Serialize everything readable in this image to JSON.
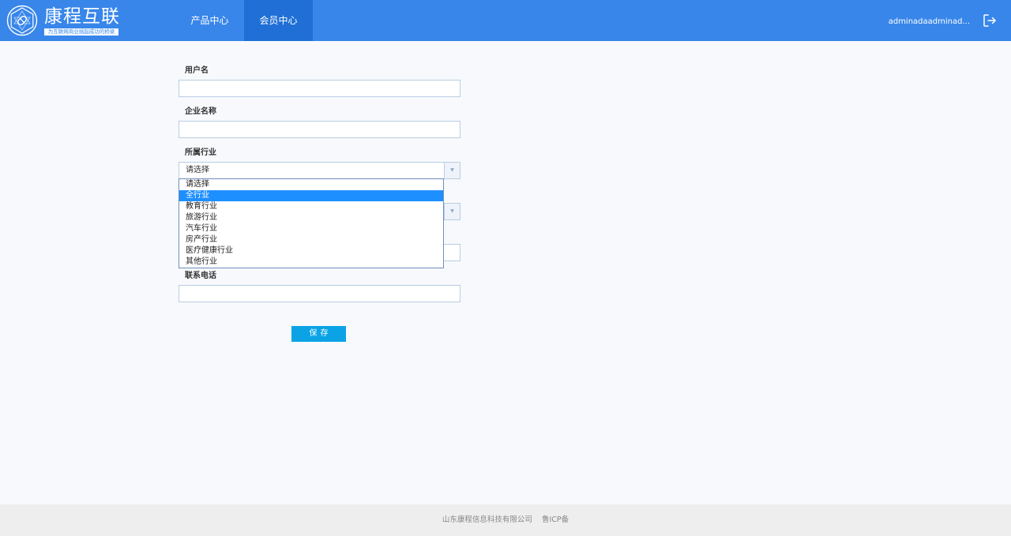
{
  "brand": {
    "title": "康程互联",
    "slogan": "为互联网商业插起成功的桥梁",
    "primary_color": "#3886ea"
  },
  "nav": {
    "items": [
      {
        "label": "产品中心",
        "active": false
      },
      {
        "label": "会员中心",
        "active": true
      }
    ]
  },
  "user": {
    "name": "adminadaadminad...",
    "logout_icon": "logout-icon"
  },
  "form": {
    "username": {
      "label": "用户名",
      "value": ""
    },
    "company": {
      "label": "企业名称",
      "value": ""
    },
    "industry": {
      "label": "所属行业",
      "selected": "请选择",
      "options": [
        "请选择",
        "全行业",
        "教育行业",
        "旅游行业",
        "汽车行业",
        "房产行业",
        "医疗健康行业",
        "其他行业"
      ],
      "highlighted": "全行业"
    },
    "phone": {
      "label": "联系电话",
      "value": ""
    },
    "save_label": "保存"
  },
  "footer": {
    "company": "山东康程信息科技有限公司",
    "icp": "鲁ICP备"
  }
}
